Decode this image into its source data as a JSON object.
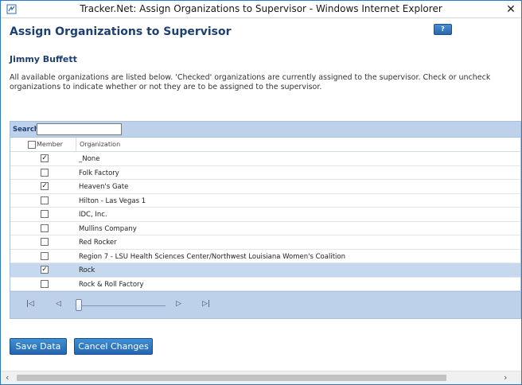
{
  "window": {
    "title": "Tracker.Net: Assign Organizations to Supervisor - Windows Internet Explorer",
    "close_glyph": "✕"
  },
  "page": {
    "title": "Assign Organizations to Supervisor",
    "help_label": "?",
    "supervisor_name": "Jimmy Buffett",
    "description": "All available organizations are listed below. 'Checked' organizations are currently assigned to the supervisor. Check or uncheck organizations to indicate whether or not they are to be assigned to the supervisor."
  },
  "grid": {
    "search_label": "Search:",
    "search_value": "",
    "columns": {
      "member": "Member",
      "organization": "Organization"
    },
    "rows": [
      {
        "organization": "_None",
        "checked": true,
        "selected": false
      },
      {
        "organization": "Folk Factory",
        "checked": false,
        "selected": false
      },
      {
        "organization": "Heaven's Gate",
        "checked": true,
        "selected": false
      },
      {
        "organization": "Hilton - Las Vegas 1",
        "checked": false,
        "selected": false
      },
      {
        "organization": "IDC, Inc.",
        "checked": false,
        "selected": false
      },
      {
        "organization": "Mullins Company",
        "checked": false,
        "selected": false
      },
      {
        "organization": "Red Rocker",
        "checked": false,
        "selected": false
      },
      {
        "organization": "Region 7 - LSU Health Sciences Center/Northwest Louisiana Women's Coalition",
        "checked": false,
        "selected": false
      },
      {
        "organization": "Rock",
        "checked": true,
        "selected": true
      },
      {
        "organization": "Rock & Roll Factory",
        "checked": false,
        "selected": false
      }
    ],
    "pager": {
      "first": "|◁",
      "prev": "◁",
      "next": "▷",
      "last": "▷|"
    }
  },
  "actions": {
    "save_label": "Save Data",
    "cancel_label": "Cancel Changes"
  },
  "scrollbar": {
    "left_arrow": "‹",
    "right_arrow": "›"
  }
}
